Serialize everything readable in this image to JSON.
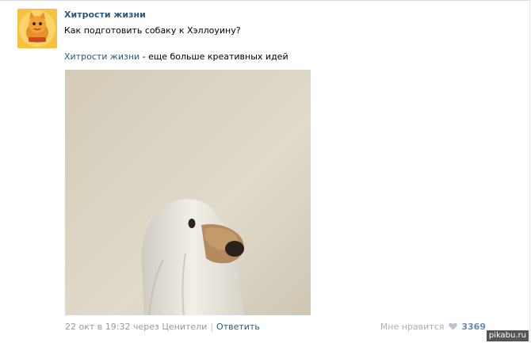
{
  "post": {
    "author": "Хитрости жизни",
    "text": "Как подготовить собаку к Хэллоуину?",
    "promo": {
      "link": "Хитрости жизни",
      "suffix": " - еще больше креативных идей"
    },
    "photo_icon": "ghost-dog-photo",
    "meta": {
      "date": "22 окт в 19:32",
      "via": "через Ценители",
      "separator": "|",
      "reply": "Ответить"
    },
    "likes": {
      "label": "Мне нравится",
      "count": "3369",
      "icon": "heart-icon"
    }
  },
  "watermark": "pikabu.ru",
  "colors": {
    "link": "#2b587a",
    "muted": "#999999"
  }
}
